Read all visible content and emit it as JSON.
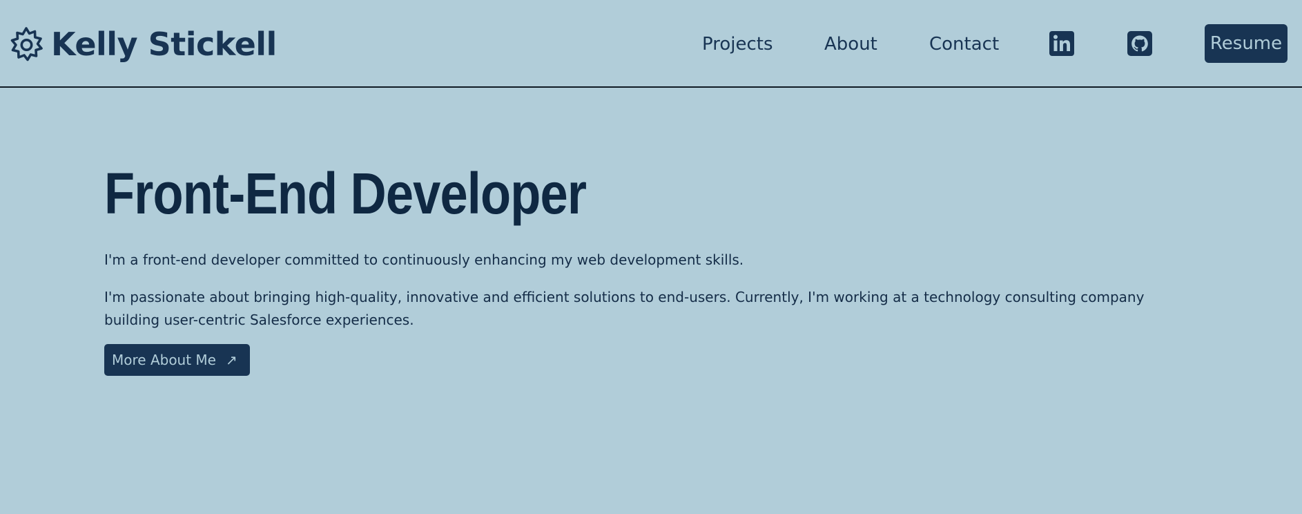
{
  "header": {
    "brand_name": "Kelly Stickell",
    "brand_icon": "gear-icon",
    "nav": {
      "projects": "Projects",
      "about": "About",
      "contact": "Contact"
    },
    "social": {
      "linkedin_icon": "linkedin-icon",
      "github_icon": "github-icon"
    },
    "resume_label": "Resume"
  },
  "hero": {
    "title": "Front-End Developer",
    "paragraph1": "I'm a front-end developer committed to continuously enhancing my web development skills.",
    "paragraph2": "I'm passionate about bringing high-quality, innovative and efficient solutions to end-users. Currently, I'm working at a technology consulting company building user-centric Salesforce experiences.",
    "cta_label": "More About Me",
    "cta_icon": "arrow-up-right-icon"
  },
  "colors": {
    "background": "#b1cdd9",
    "primary": "#183453",
    "text": "#142c47",
    "button_text": "#b1cdd9"
  }
}
